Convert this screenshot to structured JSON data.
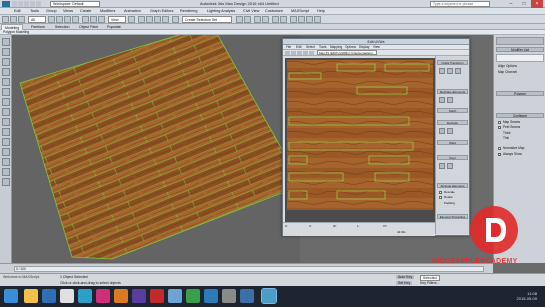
{
  "app": {
    "title": "Autodesk 3ds Max Design 2016 x64    Untitled",
    "workspace": "Workspace: Default",
    "search_placeholder": "Type a keyword or phrase"
  },
  "menu": [
    "Edit",
    "Tools",
    "Group",
    "Views",
    "Create",
    "Modifiers",
    "Animation",
    "Graph Editors",
    "Rendering",
    "Lighting Analysis",
    "Civil View",
    "Customize",
    "MAXScript",
    "Help"
  ],
  "toolbar": {
    "filter": "All",
    "view": "View",
    "selection_set": "Create Selection Set"
  },
  "ribbon": {
    "tabs": [
      "Modeling",
      "Freeform",
      "Selection",
      "Object Paint",
      "Populate"
    ],
    "active_tab": "Modeling",
    "sub_tab": "Polygon Modeling"
  },
  "uv_editor": {
    "title": "Edit UVWs",
    "menus": [
      "File",
      "Edit",
      "Select",
      "Tools",
      "Mapping",
      "Options",
      "Display",
      "View"
    ],
    "map_dropdown": "Map #3 (EDITUVWM1) (Checkerpattern)",
    "panels": [
      "Quick Transform",
      "Reshape Elements",
      "Stitch",
      "Explode",
      "Weld",
      "Peel",
      "Arrange Elements",
      "Element Properties"
    ],
    "options": [
      "Rescale",
      "Rotate",
      "Padding"
    ],
    "coords": {
      "u_label": "U:",
      "v_label": "V:",
      "w_label": "W:",
      "l_label": "L:"
    },
    "xy_label": "XY",
    "all_ids": "All IDs"
  },
  "command_panel": {
    "title": "Modifier List",
    "items": [
      "Align Options",
      "Map Channel",
      "Polygon",
      "Configure",
      "Map Seams",
      "Peel Seams",
      "Thick",
      "Thin",
      "Normalize Map",
      "Always Show"
    ]
  },
  "status": {
    "selection": "1 Object Selected",
    "hint": "Click or click-and-drag to select objects",
    "welcome": "Welcome to MAXScript.",
    "frame": "0 / 100",
    "autokey": "Auto Key",
    "setkey": "Set Key",
    "key_filters": "Key Filters...",
    "selected": "Selected"
  },
  "clock": {
    "time": "11:08",
    "date": "2015-05-09"
  },
  "watermark": {
    "text": "INCUSAPPLEACADEMY"
  },
  "colors": {
    "accent_red": "#e22a2a",
    "wood_light": "#a9642e",
    "wood_dark": "#6e3d1c",
    "uv_green": "#7ecf3b"
  }
}
